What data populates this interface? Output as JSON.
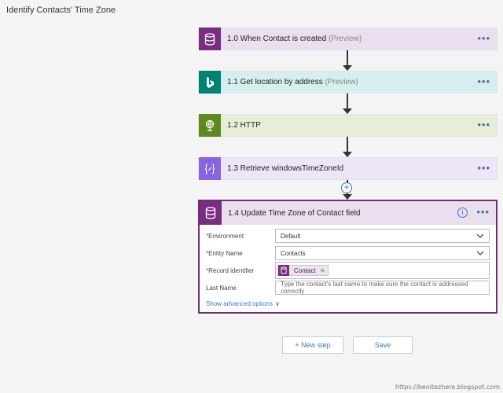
{
  "page": {
    "title": "Identify Contacts' Time Zone"
  },
  "steps": [
    {
      "label": "1.0 When Contact is created",
      "suffix": "(Preview)",
      "icon": "database-icon",
      "accent": "#7a2c80",
      "bg": "#eadfee"
    },
    {
      "label": "1.1 Get location by address",
      "suffix": "(Preview)",
      "icon": "bing-icon",
      "accent": "#008272",
      "bg": "#d6eeee"
    },
    {
      "label": "1.2 HTTP",
      "suffix": "",
      "icon": "globe-icon",
      "accent": "#5d8a1f",
      "bg": "#e6eed8"
    },
    {
      "label": "1.3 Retrieve windowsTimeZoneId",
      "suffix": "",
      "icon": "expression-icon",
      "accent": "#8764e0",
      "bg": "#ece6f7"
    }
  ],
  "more_glyph": "•••",
  "add_glyph": "+",
  "card": {
    "title": "1.4 Update Time Zone of Contact field",
    "info_glyph": "i",
    "fields": [
      {
        "label": "Environment",
        "required": "*",
        "value": "Default",
        "type": "select"
      },
      {
        "label": "Entity Name",
        "required": "*",
        "value": "Contacts",
        "type": "select"
      },
      {
        "label": "Record identifier",
        "required": "*",
        "token": "Contact",
        "token_close": "×",
        "type": "token"
      },
      {
        "label": "Last Name",
        "required": "",
        "placeholder": "Type the contact's last name to make sure the contact is addressed correctly",
        "type": "text"
      }
    ],
    "advanced_link": "Show advanced options",
    "advanced_chevron": "∨"
  },
  "buttons": {
    "new_step": "+ New step",
    "save": "Save"
  },
  "watermark": "https://benitezhere.blogspot.com",
  "colors": {
    "accent_blue": "#3b78c3",
    "card_border": "#6f2e79"
  }
}
